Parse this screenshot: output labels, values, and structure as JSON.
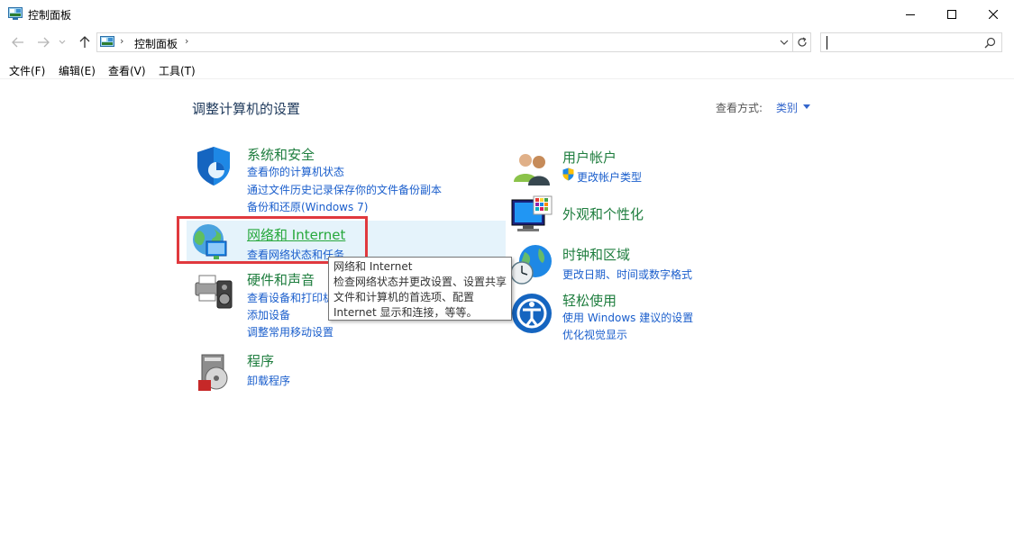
{
  "window": {
    "title": "控制面板"
  },
  "address": {
    "crumb": "控制面板",
    "search_placeholder": ""
  },
  "menu": {
    "file": "文件(F)",
    "edit": "编辑(E)",
    "view": "查看(V)",
    "tools": "工具(T)"
  },
  "content": {
    "title": "调整计算机的设置",
    "view_label": "查看方式:",
    "view_value": "类别"
  },
  "categories_left": [
    {
      "title": "系统和安全",
      "icon": "shield-icon",
      "links": [
        "查看你的计算机状态",
        "通过文件历史记录保存你的文件备份副本",
        "备份和还原(Windows 7)"
      ]
    },
    {
      "title": "网络和 Internet",
      "icon": "network-globe-icon",
      "links": [
        "查看网络状态和任务"
      ]
    },
    {
      "title": "硬件和声音",
      "icon": "printer-speaker-icon",
      "links": [
        "查看设备和打印机",
        "添加设备",
        "调整常用移动设置"
      ]
    },
    {
      "title": "程序",
      "icon": "programs-disc-icon",
      "links": [
        "卸载程序"
      ]
    }
  ],
  "categories_right": [
    {
      "title": "用户帐户",
      "icon": "users-icon",
      "links": [
        "更改帐户类型"
      ]
    },
    {
      "title": "外观和个性化",
      "icon": "monitor-palette-icon",
      "links": []
    },
    {
      "title": "时钟和区域",
      "icon": "clock-globe-icon",
      "links": [
        "更改日期、时间或数字格式"
      ]
    },
    {
      "title": "轻松使用",
      "icon": "ease-of-access-icon",
      "links": [
        "使用 Windows 建议的设置",
        "优化视觉显示"
      ]
    }
  ],
  "tooltip": {
    "lines": [
      "网络和 Internet",
      "检查网络状态并更改设置、设置共享",
      "文件和计算机的首选项、配置",
      "Internet 显示和连接，等等。"
    ]
  },
  "colors": {
    "category_title": "#1e7d3e",
    "link": "#1a5ecc",
    "highlight": "#e0393e",
    "hover": "#e5f3fb"
  }
}
